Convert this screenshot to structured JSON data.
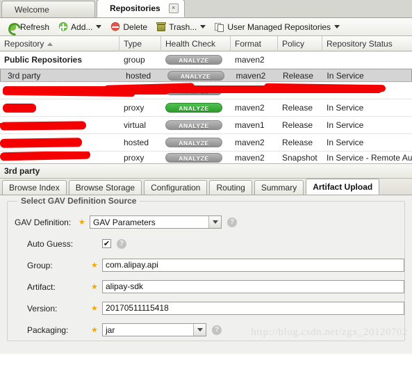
{
  "tabs": [
    {
      "label": "Welcome",
      "active": false,
      "closable": false
    },
    {
      "label": "Repositories",
      "active": true,
      "closable": true,
      "close_glyph": "×"
    }
  ],
  "toolbar": {
    "refresh": {
      "label": "Refresh",
      "icon": "refresh-icon"
    },
    "add": {
      "label": "Add...",
      "icon": "add-icon",
      "has_menu": true
    },
    "delete": {
      "label": "Delete",
      "icon": "delete-icon"
    },
    "trash": {
      "label": "Trash...",
      "icon": "trash-icon",
      "has_menu": true
    },
    "user_managed": {
      "label": "User Managed Repositories",
      "icon": "copy-icon",
      "has_menu": true
    }
  },
  "grid": {
    "columns": [
      {
        "label": "Repository",
        "width": 172,
        "sorted": "asc"
      },
      {
        "label": "Type",
        "width": 60
      },
      {
        "label": "Health Check",
        "width": 100
      },
      {
        "label": "Format",
        "width": 68
      },
      {
        "label": "Policy",
        "width": 64
      },
      {
        "label": "Repository Status",
        "width": 129
      }
    ],
    "rows": [
      {
        "repository": "Public Repositories",
        "bold": true,
        "type": "group",
        "health": "ANALYZE",
        "health_state": "grey",
        "format": "maven2",
        "policy": "",
        "status": "",
        "redacted": false,
        "selected": false
      },
      {
        "repository": "3rd party",
        "bold": false,
        "type": "hosted",
        "health": "ANALYZE",
        "health_state": "grey",
        "format": "maven2",
        "policy": "Release",
        "status": "In Service",
        "redacted": false,
        "selected": true
      },
      {
        "repository": "",
        "bold": false,
        "type": "",
        "health": "ANALYZE",
        "health_state": "grey",
        "format": "",
        "policy": "",
        "status": "",
        "redacted": true,
        "selected": false
      },
      {
        "repository": "",
        "bold": false,
        "type": "proxy",
        "health": "ANALYZE",
        "health_state": "green",
        "format": "maven2",
        "policy": "Release",
        "status": "In Service",
        "redacted": true,
        "selected": false
      },
      {
        "repository": "",
        "bold": false,
        "type": "virtual",
        "health": "ANALYZE",
        "health_state": "grey",
        "format": "maven1",
        "policy": "Release",
        "status": "In Service",
        "redacted": true,
        "selected": false
      },
      {
        "repository": "",
        "bold": false,
        "type": "hosted",
        "health": "ANALYZE",
        "health_state": "grey",
        "format": "maven2",
        "policy": "Release",
        "status": "In Service",
        "redacted": true,
        "selected": false
      },
      {
        "repository": "",
        "bold": false,
        "type": "proxy",
        "health": "ANALYZE",
        "health_state": "grey",
        "format": "maven2",
        "policy": "Snapshot",
        "status": "In Service - Remote Au",
        "redacted": true,
        "selected": false
      }
    ],
    "analyze_label": "ANALYZE",
    "colors": {
      "analyze_grey": "#8f8f8f",
      "analyze_green": "#2e9c2e",
      "redaction": "#f40000",
      "selected_row": "#d4d4d4"
    }
  },
  "detail": {
    "title": "3rd party",
    "subtabs": [
      {
        "label": "Browse Index",
        "active": false
      },
      {
        "label": "Browse Storage",
        "active": false
      },
      {
        "label": "Configuration",
        "active": false
      },
      {
        "label": "Routing",
        "active": false
      },
      {
        "label": "Summary",
        "active": false
      },
      {
        "label": "Artifact Upload",
        "active": true
      }
    ]
  },
  "form": {
    "legend": "Select GAV Definition Source",
    "required_marker": "★",
    "help_glyph": "?",
    "fields": [
      {
        "label": "GAV Definition:",
        "type": "select",
        "value": "GAV Parameters",
        "required": true,
        "help": true,
        "indent": false
      },
      {
        "label": "Auto Guess:",
        "type": "checkbox",
        "value": "✔",
        "checked": true,
        "required": false,
        "help": true,
        "indent": true
      },
      {
        "label": "Group:",
        "type": "text",
        "value": "com.alipay.api",
        "required": true,
        "help": false,
        "indent": true
      },
      {
        "label": "Artifact:",
        "type": "text",
        "value": "alipay-sdk",
        "required": true,
        "help": false,
        "indent": true
      },
      {
        "label": "Version:",
        "type": "text",
        "value": "20170511115418",
        "required": true,
        "help": false,
        "indent": true
      },
      {
        "label": "Packaging:",
        "type": "select",
        "value": "jar",
        "required": true,
        "help": true,
        "indent": true
      }
    ]
  },
  "watermark": "http://blog.csdn.net/zgx_20120702"
}
